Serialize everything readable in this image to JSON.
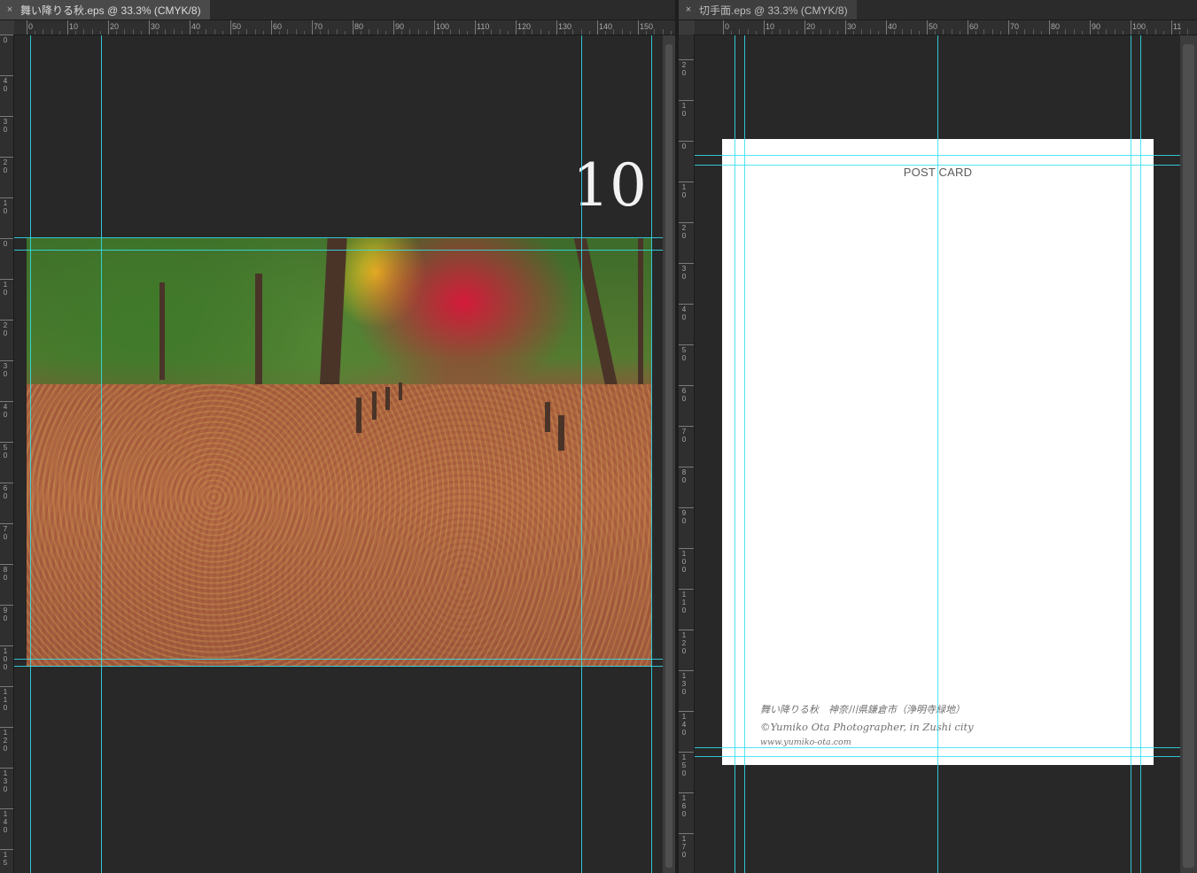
{
  "documents": [
    {
      "tab_title": "舞い降りる秋.eps @ 33.3% (CMYK/8)",
      "close_glyph": "×",
      "hruler_labels": [
        "0",
        "10",
        "20",
        "30",
        "40",
        "50",
        "60",
        "70",
        "80",
        "90",
        "100",
        "110",
        "120",
        "130",
        "140",
        "150"
      ],
      "vruler_labels": [
        "0",
        "4\n0",
        "3\n0",
        "2\n0",
        "1\n0",
        "0",
        "1\n0",
        "2\n0",
        "3\n0",
        "4\n0",
        "5\n0",
        "6\n0",
        "7\n0",
        "8\n0",
        "9\n0",
        "1\n0\n0",
        "1\n1\n0",
        "1\n2\n0",
        "1\n3\n0",
        "1\n4\n0",
        "1\n5"
      ],
      "page_number": "10",
      "photo_subject": "autumn-leaf-covered-path-photo"
    },
    {
      "tab_title": "切手面.eps @ 33.3% (CMYK/8)",
      "close_glyph": "×",
      "hruler_labels": [
        "0",
        "10",
        "20",
        "30",
        "40",
        "50",
        "60",
        "70",
        "80",
        "90",
        "100",
        "11"
      ],
      "vruler_labels": [
        "2\n0",
        "1\n0",
        "0",
        "1\n0",
        "2\n0",
        "3\n0",
        "4\n0",
        "5\n0",
        "6\n0",
        "7\n0",
        "8\n0",
        "9\n0",
        "1\n0\n0",
        "1\n1\n0",
        "1\n2\n0",
        "1\n3\n0",
        "1\n4\n0",
        "1\n5\n0",
        "1\n6\n0",
        "1\n7\n0"
      ],
      "postcard": {
        "title": "POST CARD",
        "caption_line1": "舞い降りる秋　神奈川県鎌倉市（浄明寺緑地）",
        "caption_line2": "©Yumiko Ota Photographer, in Zushi city",
        "caption_line3": "www.yumiko-ota.com"
      }
    }
  ],
  "colors": {
    "guide": "#33e0f0",
    "canvas": "#282828",
    "ruler": "#2f2f2f",
    "tab_active": "#4a4a4a"
  }
}
